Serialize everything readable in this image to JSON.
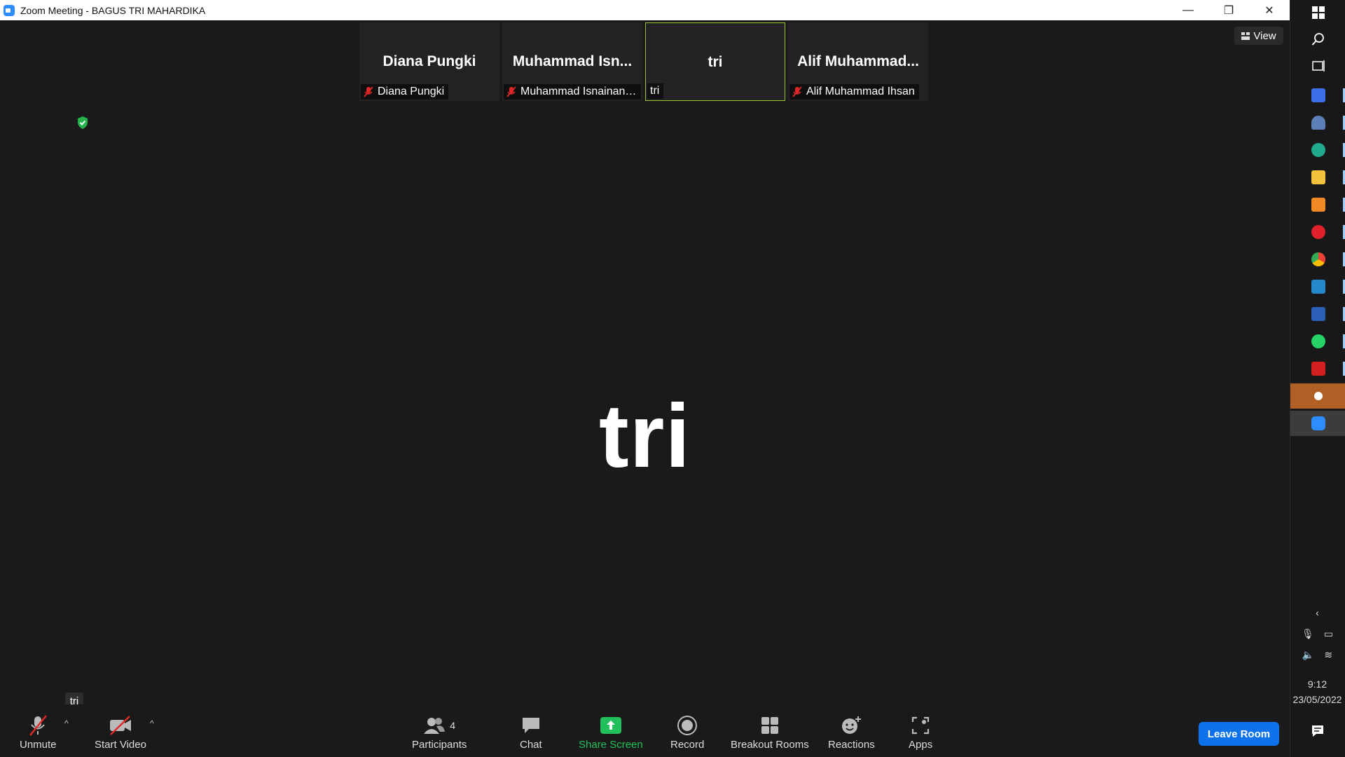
{
  "window": {
    "title": "Zoom Meeting - BAGUS TRI MAHARDIKA",
    "controls": {
      "minimize": "—",
      "restore": "❐",
      "close": "✕"
    }
  },
  "view_button": {
    "label": "View",
    "icon": "grid-view-icon"
  },
  "thumbnails": [
    {
      "display": "Diana Pungki",
      "label": "Diana Pungki",
      "muted": true,
      "active": false
    },
    {
      "display": "Muhammad  Isn...",
      "label": "Muhammad Isnainand...",
      "muted": true,
      "active": false
    },
    {
      "display": "tri",
      "label": "tri",
      "muted": false,
      "active": true
    },
    {
      "display": "Alif  Muhammad...",
      "label": "Alif Muhammad Ihsan",
      "muted": true,
      "active": false
    }
  ],
  "active_speaker": {
    "name": "tri"
  },
  "self_name_tag": "tri",
  "toolbar": {
    "unmute": "Unmute",
    "start_video": "Start Video",
    "participants": "Participants",
    "participants_count": "4",
    "chat": "Chat",
    "share_screen": "Share Screen",
    "record": "Record",
    "breakout_rooms": "Breakout Rooms",
    "reactions": "Reactions",
    "apps": "Apps",
    "leave": "Leave Room"
  },
  "colors": {
    "background": "#1a1a1a",
    "accent_blue": "#0e72ed",
    "share_green": "#21c05a",
    "mute_red": "#e02828",
    "active_border": "#9ac22a"
  },
  "taskbar": {
    "apps": [
      "windows-start-icon",
      "search-icon",
      "task-view-icon",
      "zoom-workplace-icon",
      "network-drive-icon",
      "edge-browser-icon",
      "file-explorer-icon",
      "sublime-text-icon",
      "opera-browser-icon",
      "chrome-browser-icon",
      "vscode-icon",
      "word-icon",
      "whatsapp-icon",
      "acrobat-icon",
      "recorder-icon",
      "zoom-icon"
    ],
    "clock_time": "9:12",
    "clock_date": "23/05/2022"
  }
}
